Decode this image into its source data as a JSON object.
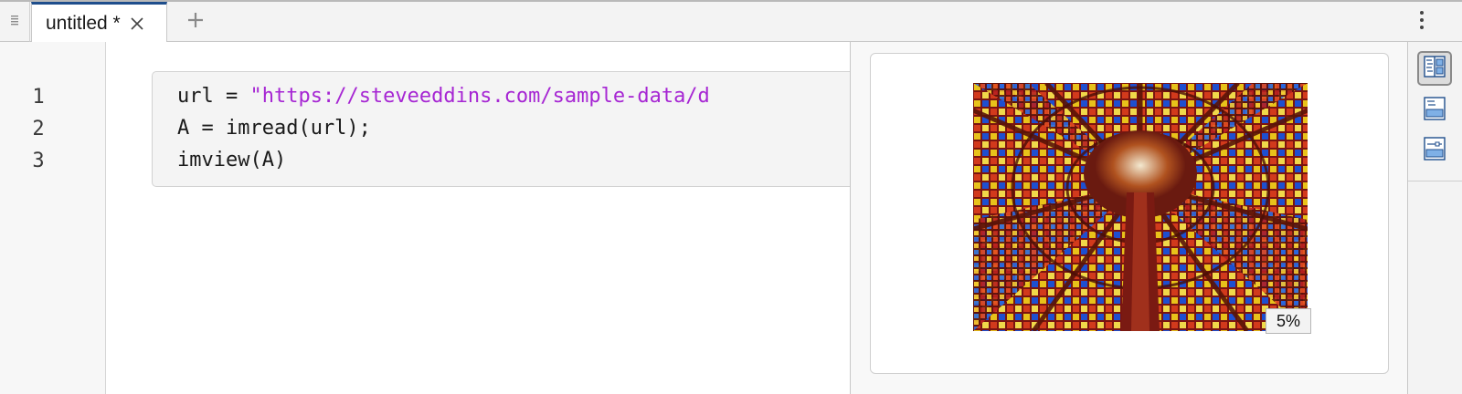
{
  "tabbar": {
    "menu_icon": "drag-handle-icon",
    "tabs": [
      {
        "label": "untitled *",
        "close_icon": "close-icon",
        "active": true
      }
    ],
    "add_icon": "plus-icon",
    "more_icon": "vertical-ellipsis-icon"
  },
  "editor": {
    "line_numbers": [
      "1",
      "2",
      "3"
    ],
    "lines": [
      {
        "prefix": "url = ",
        "string": "\"https://steveeddins.com/sample-data/d"
      },
      {
        "text": "A = imread(url);"
      },
      {
        "text": "imview(A)"
      }
    ],
    "colors": {
      "string": "#a626d3",
      "cell_background": "#f4f4f4"
    }
  },
  "output": {
    "image_alt": "stained glass dome",
    "zoom_label": "5%"
  },
  "right_toolbar": {
    "buttons": [
      {
        "icon": "output-on-right-icon",
        "active": true
      },
      {
        "icon": "output-inline-icon",
        "active": false
      },
      {
        "icon": "hide-code-icon",
        "active": false
      }
    ]
  },
  "colors": {
    "tab_accent": "#1f4e8c"
  }
}
